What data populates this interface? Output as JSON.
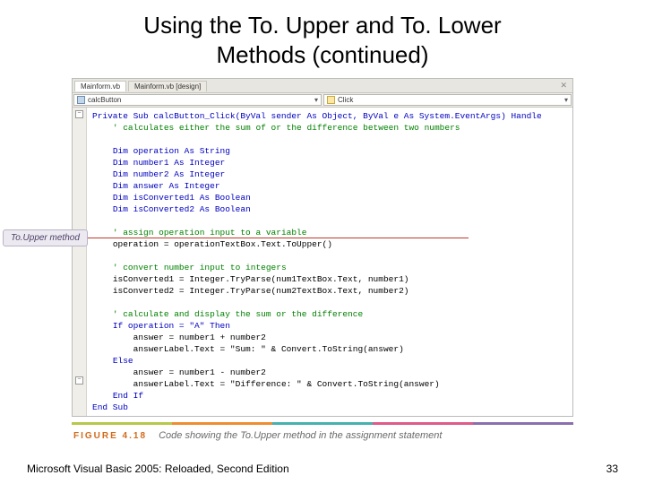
{
  "title_line1": "Using the To. Upper and To. Lower",
  "title_line2": "Methods (continued)",
  "tabs": {
    "active": "Mainform.vb",
    "inactive": "Mainform.vb [design]"
  },
  "selectors": {
    "object": "calcButton",
    "event": "Click"
  },
  "code": {
    "sub_open": "Private Sub calcButton_Click(ByVal sender As Object, ByVal e As System.EventArgs) Handle",
    "c_top": "' calculates either the sum of or the difference between two numbers",
    "d1": "Dim operation As String",
    "d2": "Dim number1 As Integer",
    "d3": "Dim number2 As Integer",
    "d4": "Dim answer As Integer",
    "d5": "Dim isConverted1 As Boolean",
    "d6": "Dim isConverted2 As Boolean",
    "c_assign": "' assign operation input to a variable",
    "op_line": "operation = operationTextBox.Text.ToUpper()",
    "c_conv": "' convert number input to integers",
    "conv1": "isConverted1 = Integer.TryParse(num1TextBox.Text, number1)",
    "conv2": "isConverted2 = Integer.TryParse(num2TextBox.Text, number2)",
    "c_calc": "' calculate and display the sum or the difference",
    "if_line": "If operation = \"A\" Then",
    "sum1": "    answer = number1 + number2",
    "sum2": "    answerLabel.Text = \"Sum: \" & Convert.ToString(answer)",
    "else_line": "Else",
    "diff1": "    answer = number1 - number2",
    "diff2": "    answerLabel.Text = \"Difference: \" & Convert.ToString(answer)",
    "endif": "End If",
    "endsub": "End Sub"
  },
  "callout": "To.Upper method",
  "figure": {
    "label": "FIGURE 4.18",
    "desc": "Code showing the To.Upper method in the assignment statement"
  },
  "footer": {
    "left": "Microsoft Visual Basic 2005: Reloaded, Second Edition",
    "right": "33"
  }
}
